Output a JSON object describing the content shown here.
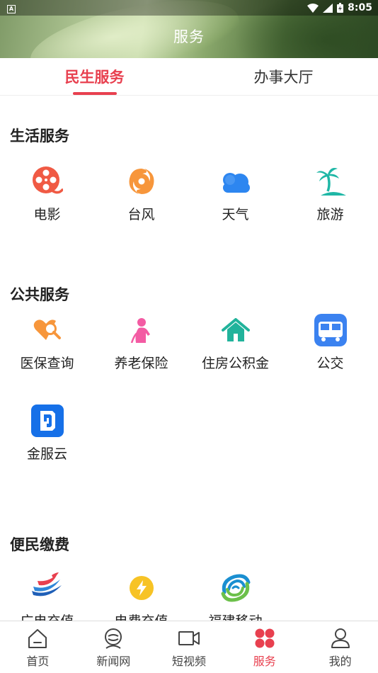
{
  "status_bar": {
    "time": "8:05"
  },
  "header": {
    "title": "服务"
  },
  "tabs": [
    {
      "label": "民生服务",
      "active": true
    },
    {
      "label": "办事大厅",
      "active": false
    }
  ],
  "sections": {
    "life": {
      "title": "生活服务",
      "items": [
        {
          "label": "电影",
          "icon": "film-reel-icon",
          "color": "#f05a44"
        },
        {
          "label": "台风",
          "icon": "typhoon-icon",
          "color": "#f7963b"
        },
        {
          "label": "天气",
          "icon": "cloud-icon",
          "color": "#2d86f0"
        },
        {
          "label": "旅游",
          "icon": "palm-tree-icon",
          "color": "#1fb7a6"
        }
      ]
    },
    "public": {
      "title": "公共服务",
      "items": [
        {
          "label": "医保查询",
          "icon": "medical-search-icon",
          "color": "#f7963b"
        },
        {
          "label": "养老保险",
          "icon": "elderly-icon",
          "color": "#f35ba3"
        },
        {
          "label": "住房公积金",
          "icon": "house-icon",
          "color": "#21b39b"
        },
        {
          "label": "公交",
          "icon": "bus-icon",
          "color": "#3b82f0"
        },
        {
          "label": "金服云",
          "icon": "jinfuyun-logo-icon",
          "color": "#1670e8"
        }
      ]
    },
    "payment": {
      "title": "便民缴费",
      "items": [
        {
          "label": "广电充值",
          "icon": "broadcast-logo-icon",
          "color": "#e8404f"
        },
        {
          "label": "电费充值",
          "icon": "lightning-icon",
          "color": "#f7c325"
        },
        {
          "label": "福建移动",
          "icon": "china-mobile-logo-icon",
          "color": "#1a8fd1"
        }
      ]
    }
  },
  "bottom_nav": [
    {
      "label": "首页",
      "icon": "home-icon",
      "active": false
    },
    {
      "label": "新闻网",
      "icon": "news-icon",
      "active": false
    },
    {
      "label": "短视频",
      "icon": "video-camera-icon",
      "active": false
    },
    {
      "label": "服务",
      "icon": "services-grid-icon",
      "active": true
    },
    {
      "label": "我的",
      "icon": "user-icon",
      "active": false
    }
  ],
  "colors": {
    "accent": "#e8404f"
  }
}
